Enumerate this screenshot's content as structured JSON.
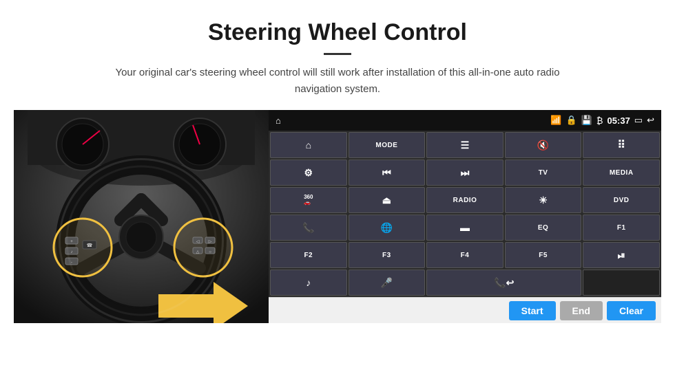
{
  "header": {
    "title": "Steering Wheel Control",
    "divider": true,
    "subtitle": "Your original car's steering wheel control will still work after installation of this all-in-one auto radio navigation system."
  },
  "status_bar": {
    "time": "05:37",
    "icons": [
      "wifi",
      "lock",
      "sd",
      "bluetooth",
      "screen",
      "back"
    ]
  },
  "button_grid": [
    {
      "id": "r1c1",
      "type": "icon",
      "icon": "▲",
      "label": "home"
    },
    {
      "id": "r1c2",
      "type": "text",
      "label": "MODE"
    },
    {
      "id": "r1c3",
      "type": "icon",
      "icon": "≡",
      "label": "list"
    },
    {
      "id": "r1c4",
      "type": "icon",
      "icon": "🔇",
      "label": "mute"
    },
    {
      "id": "r1c5",
      "type": "icon",
      "icon": "⠿",
      "label": "apps"
    },
    {
      "id": "r2c1",
      "type": "icon",
      "icon": "⚙",
      "label": "settings"
    },
    {
      "id": "r2c2",
      "type": "icon",
      "icon": "⏮",
      "label": "prev"
    },
    {
      "id": "r2c3",
      "type": "icon",
      "icon": "⏭",
      "label": "next"
    },
    {
      "id": "r2c4",
      "type": "text",
      "label": "TV"
    },
    {
      "id": "r2c5",
      "type": "text",
      "label": "MEDIA"
    },
    {
      "id": "r3c1",
      "type": "icon",
      "icon": "360",
      "label": "360cam"
    },
    {
      "id": "r3c2",
      "type": "icon",
      "icon": "⏏",
      "label": "eject"
    },
    {
      "id": "r3c3",
      "type": "text",
      "label": "RADIO"
    },
    {
      "id": "r3c4",
      "type": "icon",
      "icon": "☀",
      "label": "brightness"
    },
    {
      "id": "r3c5",
      "type": "text",
      "label": "DVD"
    },
    {
      "id": "r4c1",
      "type": "icon",
      "icon": "📞",
      "label": "phone"
    },
    {
      "id": "r4c2",
      "type": "icon",
      "icon": "🌐",
      "label": "navigation"
    },
    {
      "id": "r4c3",
      "type": "icon",
      "icon": "▬",
      "label": "display"
    },
    {
      "id": "r4c4",
      "type": "text",
      "label": "EQ"
    },
    {
      "id": "r4c5",
      "type": "text",
      "label": "F1"
    },
    {
      "id": "r5c1",
      "type": "text",
      "label": "F2"
    },
    {
      "id": "r5c2",
      "type": "text",
      "label": "F3"
    },
    {
      "id": "r5c3",
      "type": "text",
      "label": "F4"
    },
    {
      "id": "r5c4",
      "type": "text",
      "label": "F5"
    },
    {
      "id": "r5c5",
      "type": "icon",
      "icon": "⏯",
      "label": "playpause"
    },
    {
      "id": "r6c1",
      "type": "icon",
      "icon": "♪",
      "label": "music"
    },
    {
      "id": "r6c2",
      "type": "icon",
      "icon": "🎤",
      "label": "mic"
    },
    {
      "id": "r6c3",
      "type": "icon",
      "icon": "📞↩",
      "label": "call-end",
      "colspan": 2
    }
  ],
  "bottom_bar": {
    "start_label": "Start",
    "end_label": "End",
    "clear_label": "Clear"
  }
}
